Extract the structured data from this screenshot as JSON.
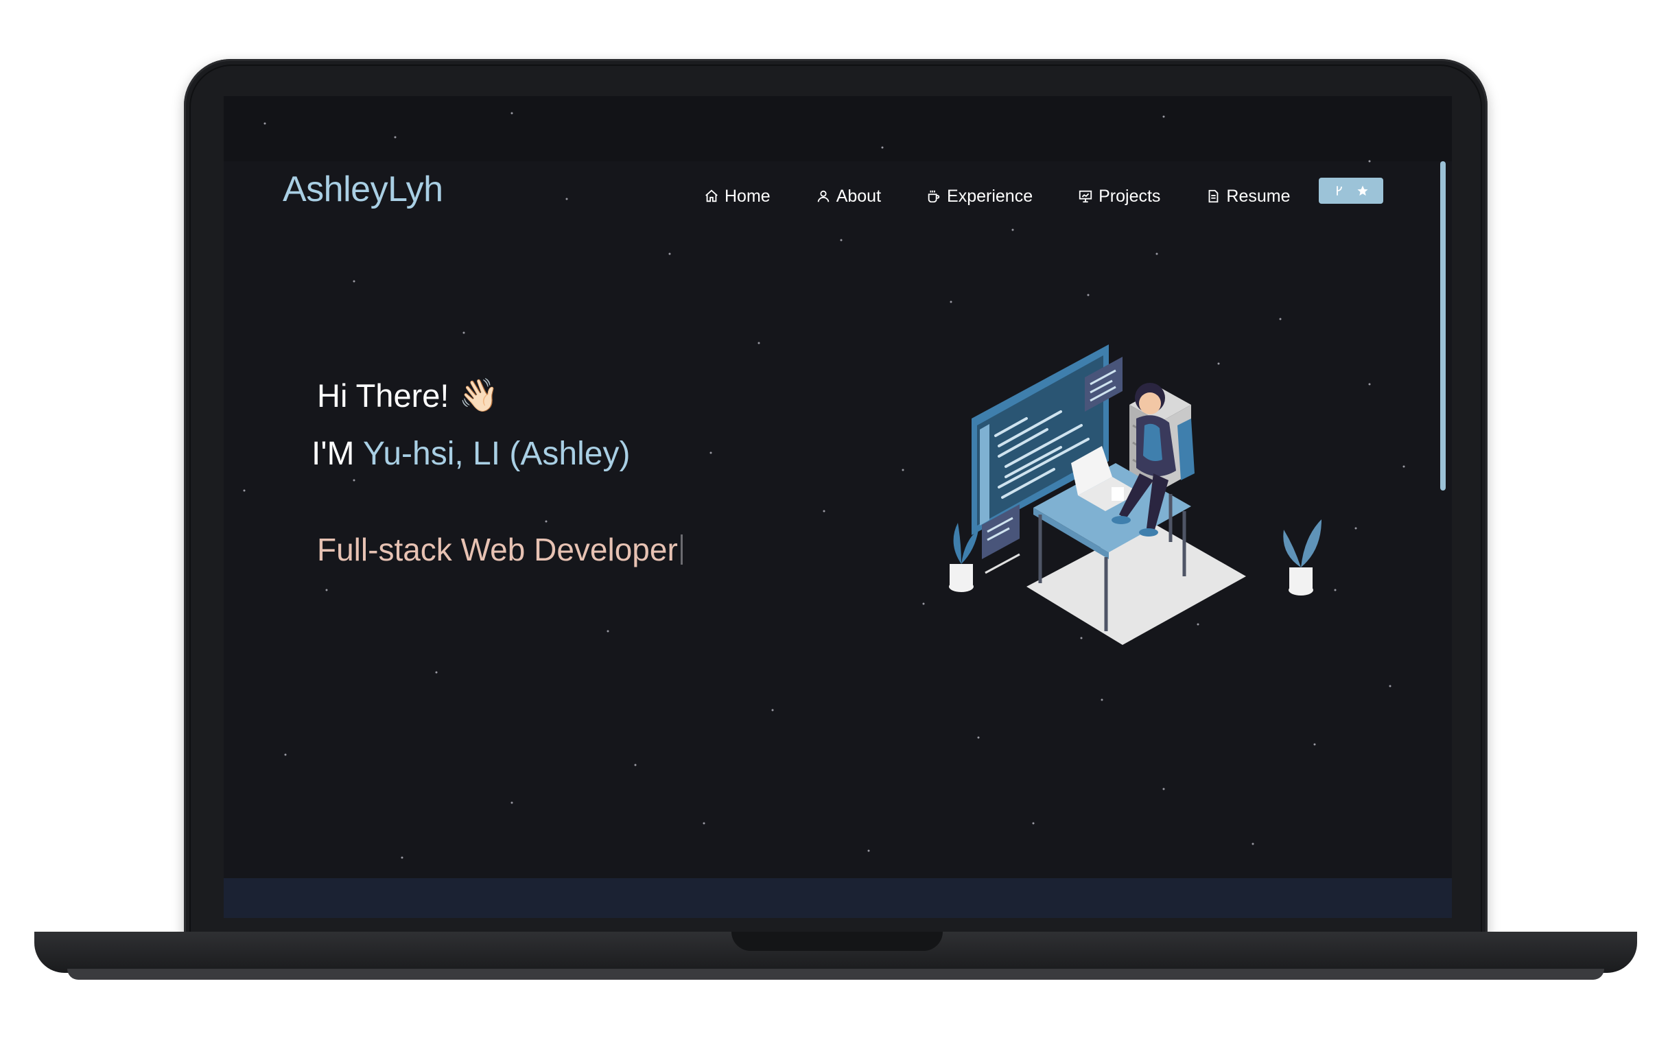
{
  "site": {
    "brand": "AshleyLyh"
  },
  "nav": {
    "items": [
      {
        "label": "Home",
        "icon": "home-icon"
      },
      {
        "label": "About",
        "icon": "user-icon"
      },
      {
        "label": "Experience",
        "icon": "coffee-icon"
      },
      {
        "label": "Projects",
        "icon": "presentation-icon"
      },
      {
        "label": "Resume",
        "icon": "document-icon"
      }
    ],
    "github_button_icons": [
      "git-fork-icon",
      "star-icon"
    ]
  },
  "hero": {
    "greeting": "Hi There!",
    "greeting_emoji": "👋🏻",
    "intro_prefix": "I'M",
    "name": "Yu-hsi, LI (Ashley)",
    "role": "Full-stack Web Developer"
  },
  "colors": {
    "background": "#15161b",
    "accent": "#a9cfe4",
    "role_text": "#e7c2b3",
    "button": "#9cc3d8"
  }
}
